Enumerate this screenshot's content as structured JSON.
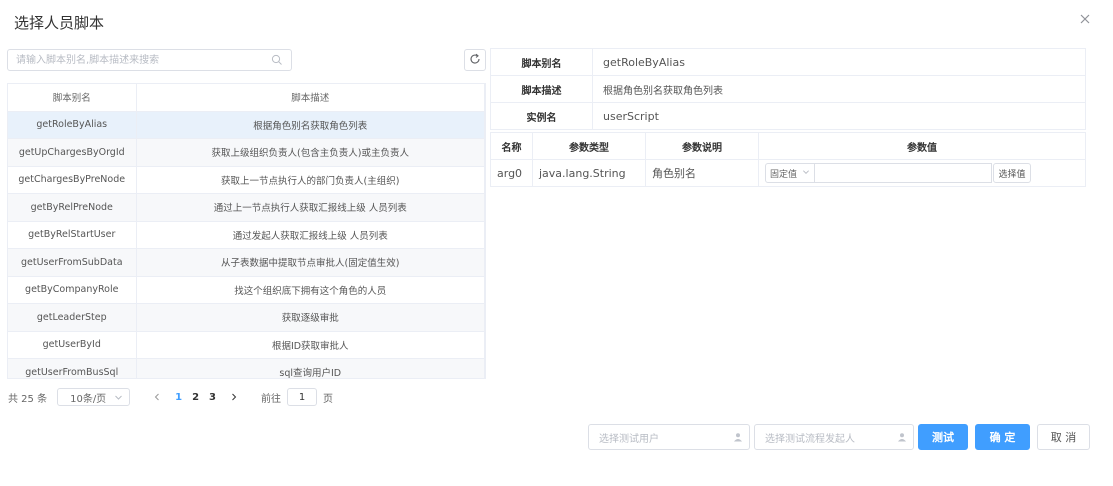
{
  "dialog": {
    "title": "选择人员脚本"
  },
  "search": {
    "placeholder": "请输入脚本别名,脚本描述来搜索"
  },
  "script_table": {
    "headers": [
      "脚本别名",
      "脚本描述"
    ],
    "rows": [
      {
        "alias": "getRoleByAlias",
        "desc": "根据角色别名获取角色列表"
      },
      {
        "alias": "getUpChargesByOrgId",
        "desc": "获取上级组织负责人(包含主负责人)或主负责人"
      },
      {
        "alias": "getChargesByPreNode",
        "desc": "获取上一节点执行人的部门负责人(主组织)"
      },
      {
        "alias": "getByRelPreNode",
        "desc": "通过上一节点执行人获取汇报线上级 人员列表"
      },
      {
        "alias": "getByRelStartUser",
        "desc": "通过发起人获取汇报线上级 人员列表"
      },
      {
        "alias": "getUserFromSubData",
        "desc": "从子表数据中提取节点审批人(固定值生效)"
      },
      {
        "alias": "getByCompanyRole",
        "desc": "找这个组织底下拥有这个角色的人员"
      },
      {
        "alias": "getLeaderStep",
        "desc": "获取逐级审批"
      },
      {
        "alias": "getUserById",
        "desc": "根据ID获取审批人"
      },
      {
        "alias": "getUserFromBusSql",
        "desc": "sql查询用户ID"
      }
    ]
  },
  "pagination": {
    "total": "共 25 条",
    "page_size": "10条/页",
    "pages": [
      "1",
      "2",
      "3"
    ],
    "goto_label": "前往",
    "goto_value": "1",
    "page_unit": "页"
  },
  "info": {
    "alias_label": "脚本别名",
    "alias_value": "getRoleByAlias",
    "desc_label": "脚本描述",
    "desc_value": "根据角色别名获取角色列表",
    "instance_label": "实例名",
    "instance_value": "userScript"
  },
  "params": {
    "headers": [
      "名称",
      "参数类型",
      "参数说明",
      "参数值"
    ],
    "rows": [
      {
        "name": "arg0",
        "type": "java.lang.String",
        "desc": "角色别名",
        "mode": "固定值",
        "value": "",
        "choose_label": "选择值"
      }
    ]
  },
  "footer": {
    "test_user_placeholder": "选择测试用户",
    "test_starter_placeholder": "选择测试流程发起人",
    "test_label": "测试",
    "confirm_label": "确 定",
    "cancel_label": "取 消"
  },
  "colors": {
    "primary": "#409eff",
    "selected_row": "#e8f1fb",
    "border": "#ebeef5"
  }
}
